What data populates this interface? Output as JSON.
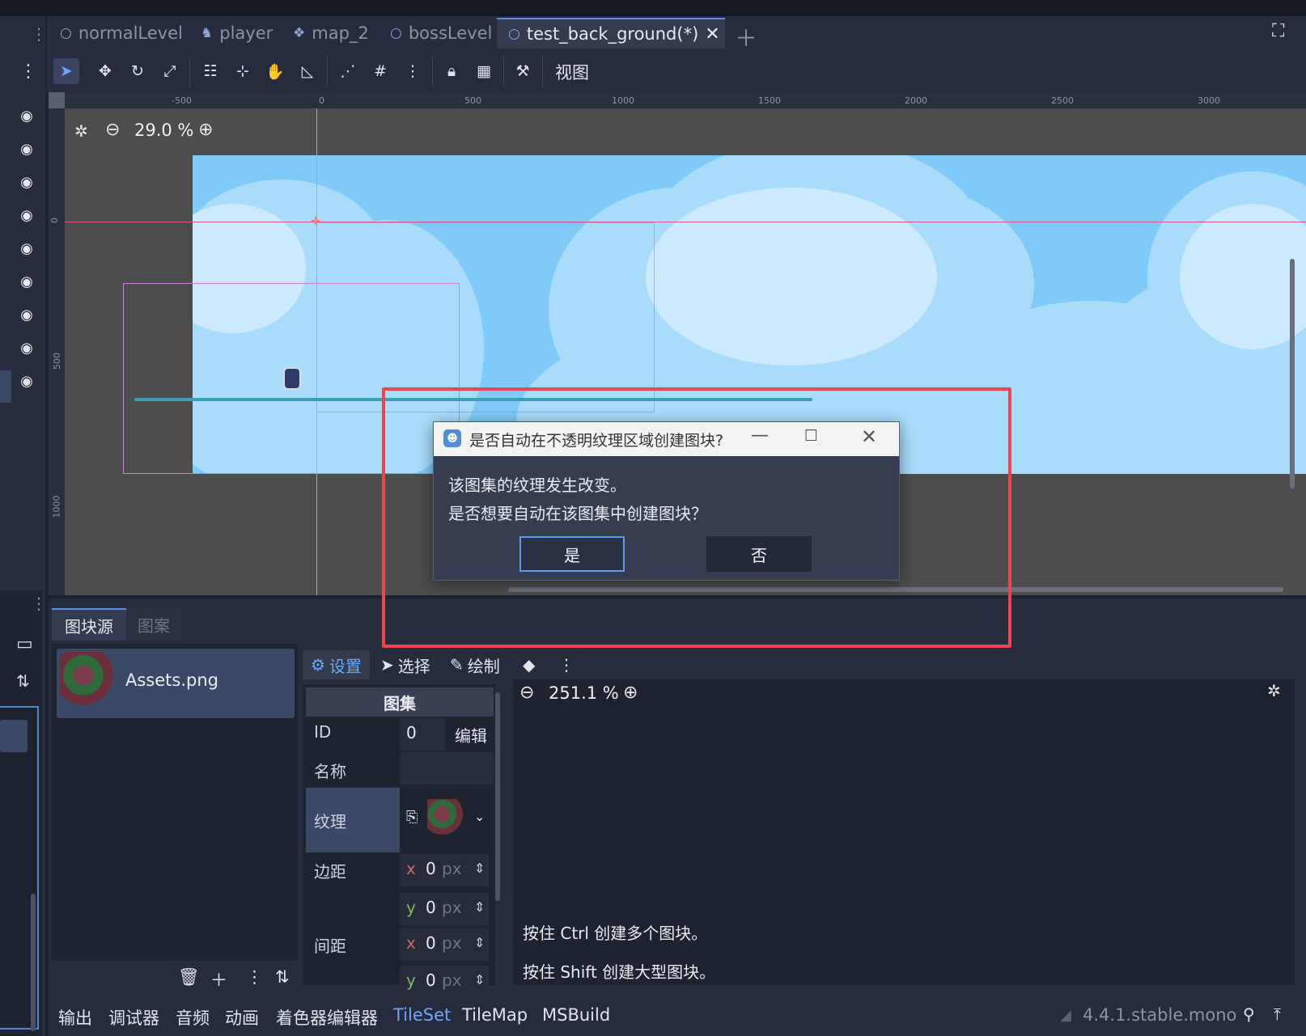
{
  "scene_tabs": [
    {
      "label": "normalLevel",
      "icon": "circle-icon"
    },
    {
      "label": "player",
      "icon": "character-icon"
    },
    {
      "label": "map_2",
      "icon": "grid-icon"
    },
    {
      "label": "bossLevel",
      "icon": "circle-icon"
    },
    {
      "label": "test_back_ground(*)",
      "icon": "circle-icon",
      "active": true
    }
  ],
  "toolbar": {
    "view_menu": "视图"
  },
  "viewport": {
    "zoom_level": "29.0 %",
    "ruler_top": [
      "-500",
      "0",
      "500",
      "1000",
      "1500",
      "2000",
      "2500",
      "3000"
    ],
    "ruler_left": [
      "0",
      "500",
      "1000"
    ]
  },
  "dialog": {
    "title": "是否自动在不透明纹理区域创建图块?",
    "line1": "该图集的纹理发生改变。",
    "line2": "是否想要自动在该图集中创建图块？",
    "yes": "是",
    "no": "否"
  },
  "bottom_panel": {
    "tab_sources": "图块源",
    "tab_patterns": "图案",
    "source_item": "Assets.png",
    "tileset_tabs": [
      "设置",
      "选择",
      "绘制"
    ],
    "inspector": {
      "header": "图集",
      "id_label": "ID",
      "id_value": "0",
      "edit_label": "编辑",
      "name_label": "名称",
      "texture_label": "纹理",
      "margin_label": "边距",
      "separation_label": "间距",
      "axis_x": "x",
      "axis_y": "y",
      "zero": "0",
      "unit": "px"
    },
    "atlas_zoom": "251.1 %",
    "hint_ctrl": "按住 Ctrl 创建多个图块。",
    "hint_shift": "按住 Shift 创建大型图块。"
  },
  "statusbar": {
    "tabs": [
      "输出",
      "调试器",
      "音频",
      "动画",
      "着色器编辑器",
      "TileSet",
      "TileMap",
      "MSBuild"
    ],
    "active": "TileSet",
    "version": "4.4.1.stable.mono"
  },
  "colors": {
    "accent": "#5a9cf0",
    "highlight_box": "#e9464f",
    "sky": "#7fcaf9"
  }
}
